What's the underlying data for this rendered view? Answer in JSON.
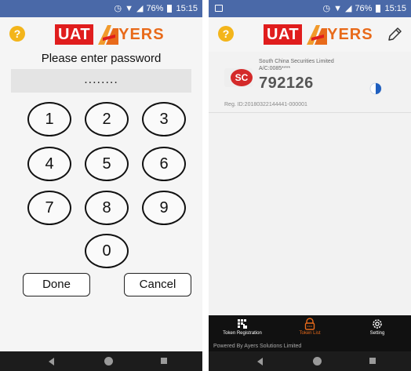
{
  "status_bar": {
    "battery": "76%",
    "time": "15:15"
  },
  "logo": {
    "prefix": "UAT",
    "word": "YERS"
  },
  "login": {
    "prompt": "Please enter password",
    "password_mask": "........",
    "keys": [
      "1",
      "2",
      "3",
      "4",
      "5",
      "6",
      "7",
      "8",
      "9",
      "0"
    ],
    "done_label": "Done",
    "cancel_label": "Cancel"
  },
  "token": {
    "company": "South China Securities Limited",
    "account": "A/C:0085****",
    "code": "792126",
    "reg_id": "Reg. ID:20180322144441-000001",
    "logo_text": "SC"
  },
  "tabs": [
    {
      "label": "Token Registration",
      "icon": "keypad-hand-icon"
    },
    {
      "label": "Token List",
      "icon": "token-list-icon"
    },
    {
      "label": "Setting",
      "icon": "gear-icon"
    }
  ],
  "footer": {
    "powered_by": "Powered By Ayers Solutions Limited"
  },
  "colors": {
    "status_bar": "#4a69a8",
    "brand_red": "#e01d1d",
    "brand_orange": "#e86a1a",
    "help_yellow": "#f3b51b",
    "tab_bar": "#111111"
  }
}
